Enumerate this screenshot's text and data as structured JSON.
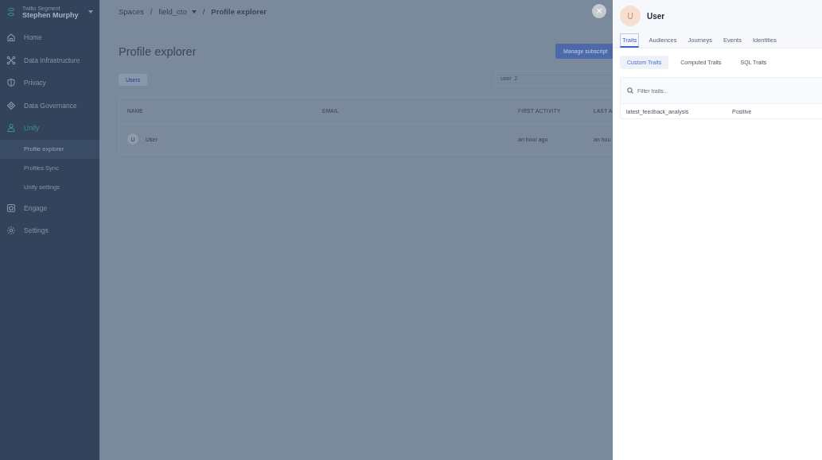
{
  "sidebar": {
    "org": "Twilio Segment",
    "user": "Stephen Murphy",
    "items": [
      {
        "label": "Home",
        "selected": false
      },
      {
        "label": "Data Infrastructure",
        "selected": false
      },
      {
        "label": "Privacy",
        "selected": false
      },
      {
        "label": "Data Governance",
        "selected": false
      },
      {
        "label": "Unify",
        "selected": true,
        "children": [
          {
            "label": "Profile explorer",
            "selected": true
          },
          {
            "label": "Profiles Sync",
            "selected": false
          },
          {
            "label": "Unify settings",
            "selected": false
          }
        ]
      },
      {
        "label": "Engage",
        "selected": false
      },
      {
        "label": "Settings",
        "selected": false
      }
    ]
  },
  "breadcrumb": [
    {
      "kind": "link",
      "label": "Spaces"
    },
    {
      "kind": "separator",
      "label": "/"
    },
    {
      "kind": "dropdown",
      "label": "field_cto"
    },
    {
      "kind": "separator",
      "label": "/"
    },
    {
      "kind": "current",
      "label": "Profile explorer"
    }
  ],
  "page": {
    "title": "Profile explorer",
    "button": "Manage subscript",
    "filter_tabs": [
      {
        "label": "Users",
        "selected": true
      }
    ],
    "search": {
      "value": "user_2"
    }
  },
  "table": {
    "columns": [
      "NAME",
      "EMAIL",
      "FIRST ACTIVITY",
      "LAST A"
    ],
    "rows": [
      {
        "avatar": "U",
        "name": "User",
        "first_activity": "an hour ago",
        "last_activity": "an hou"
      }
    ]
  },
  "drawer": {
    "close": "×",
    "avatar": "U",
    "name": "User",
    "tabs": [
      {
        "label": "Traits",
        "selected": true
      },
      {
        "label": "Audiences",
        "selected": false
      },
      {
        "label": "Journeys",
        "selected": false
      },
      {
        "label": "Events",
        "selected": false
      },
      {
        "label": "Identities",
        "selected": false
      }
    ],
    "subtabs": [
      {
        "label": "Custom Traits",
        "selected": true
      },
      {
        "label": "Computed Traits",
        "selected": false
      },
      {
        "label": "SQL Traits",
        "selected": false
      }
    ],
    "filter": {
      "placeholder": "Filter traits..."
    },
    "traits": [
      {
        "key": "latest_feedback_analysis",
        "value": "Positive"
      }
    ]
  }
}
